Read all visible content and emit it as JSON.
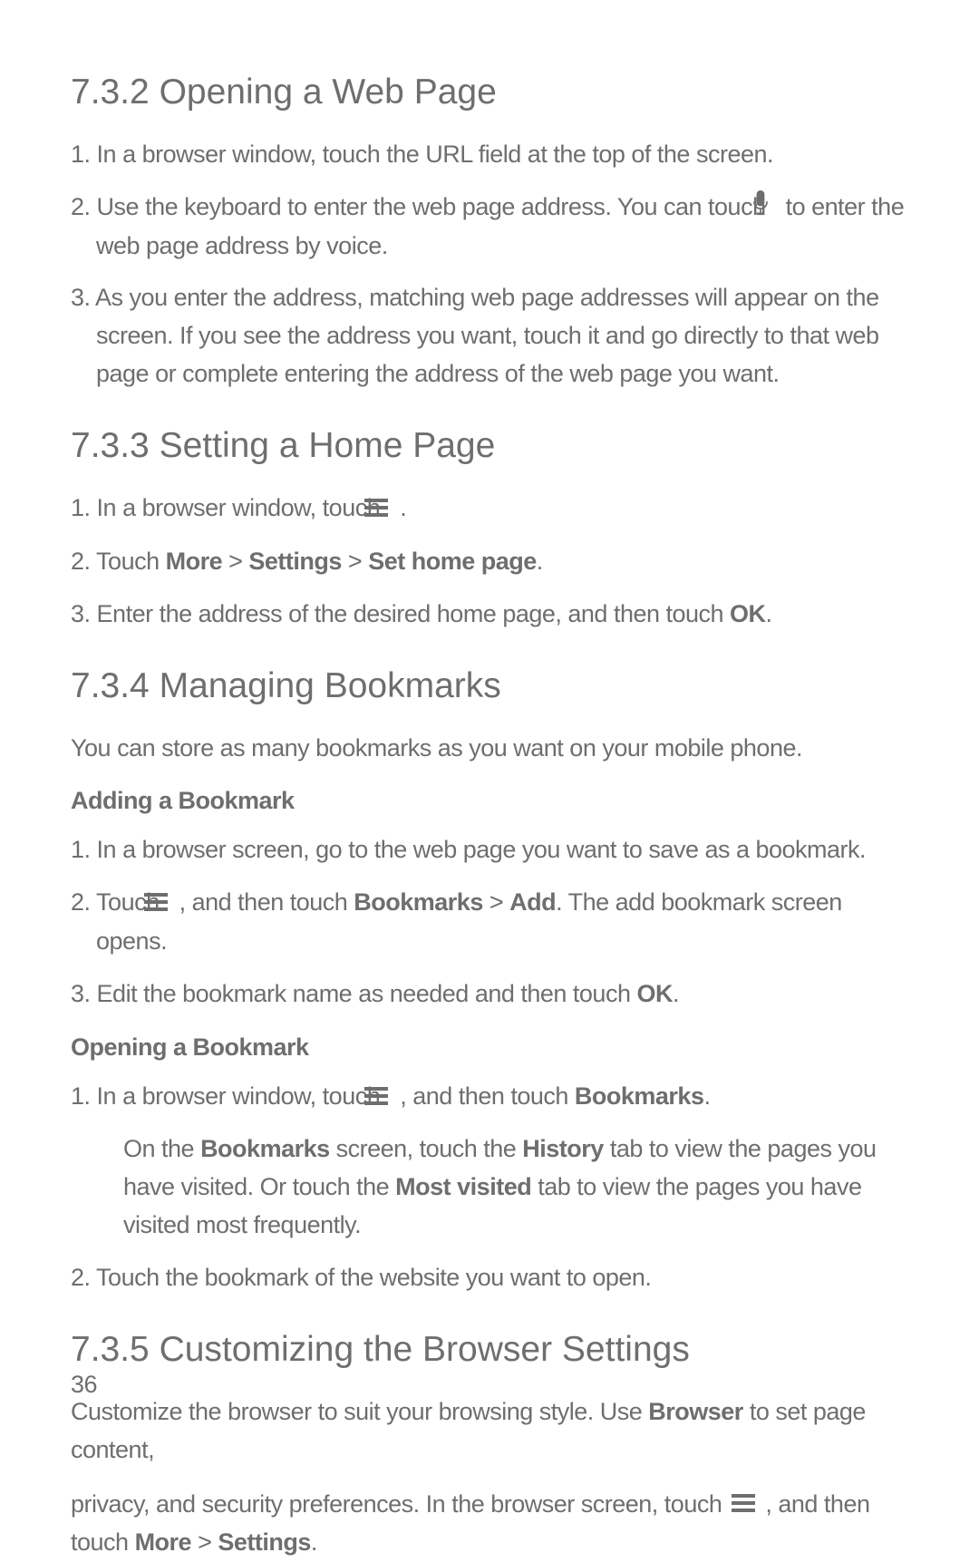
{
  "s732": {
    "heading": "7.3.2  Opening a Web Page",
    "items": [
      {
        "num": "1.",
        "text": "In a browser window, touch the URL field at the top of the screen."
      },
      {
        "num": "2.",
        "pre": "Use the keyboard to enter the web page address. You can touch ",
        "post": " to enter the web page address by voice.",
        "icon": "mic"
      },
      {
        "num": "3.",
        "text": "As you enter the address, matching web page addresses will appear on the screen. If you see the address you want, touch it and go directly to that web page or complete entering the address of the web page you want."
      }
    ]
  },
  "s733": {
    "heading": "7.3.3  Setting a Home Page",
    "items": [
      {
        "num": "1.",
        "pre": "In a browser window, touch ",
        "post": " .",
        "icon": "menu"
      },
      {
        "num": "2.",
        "text_pre": "Touch ",
        "bold1": "More",
        "mid1": " > ",
        "bold2": "Settings",
        "mid2": " > ",
        "bold3": "Set home page",
        "text_post": "."
      },
      {
        "num": "3.",
        "text_pre": "Enter the address of the desired home page, and then touch ",
        "bold1": "OK",
        "text_post": "."
      }
    ]
  },
  "s734": {
    "heading": "7.3.4  Managing Bookmarks",
    "intro": "You can store as many bookmarks as you want on your mobile phone.",
    "sub1": {
      "title": "Adding a Bookmark",
      "items": [
        {
          "num": "1.",
          "text": "In a browser screen, go to the web page you want to save as a bookmark."
        },
        {
          "num": "2.",
          "pre": "Touch ",
          "icon": "menu",
          "mid": " , and then touch ",
          "bold1": "Bookmarks",
          "mid2": " > ",
          "bold2": "Add",
          "post": ". The add bookmark screen opens."
        },
        {
          "num": "3.",
          "pre": "Edit the bookmark name as needed and then touch ",
          "bold1": "OK",
          "post": "."
        }
      ]
    },
    "sub2": {
      "title": "Opening a Bookmark",
      "items": [
        {
          "num": "1.",
          "pre": "In a browser window, touch ",
          "icon": "menu",
          "mid": " , and then touch ",
          "bold1": "Bookmarks",
          "post": "."
        },
        {
          "sub_pre": "On the ",
          "sub_b1": "Bookmarks",
          "sub_mid1": " screen, touch the ",
          "sub_b2": "History",
          "sub_mid2": " tab to view the pages you have visited. Or touch the ",
          "sub_b3": "Most visited",
          "sub_post": " tab to view the pages you have visited most frequently."
        },
        {
          "num": "2.",
          "text": "Touch the bookmark of the website you want to open."
        }
      ]
    }
  },
  "s735": {
    "heading": "7.3.5  Customizing the Browser Settings",
    "p1_pre": "Customize the browser to suit your browsing style. Use ",
    "p1_b1": "Browser",
    "p1_post": " to set page content,",
    "p2_pre": "privacy, and security preferences. In the browser screen, touch ",
    "p2_icon": "menu",
    "p2_mid": " , and then touch ",
    "p2_b1": "More",
    "p2_mid2": " > ",
    "p2_b2": "Settings",
    "p2_post": "."
  },
  "page_number": "36"
}
